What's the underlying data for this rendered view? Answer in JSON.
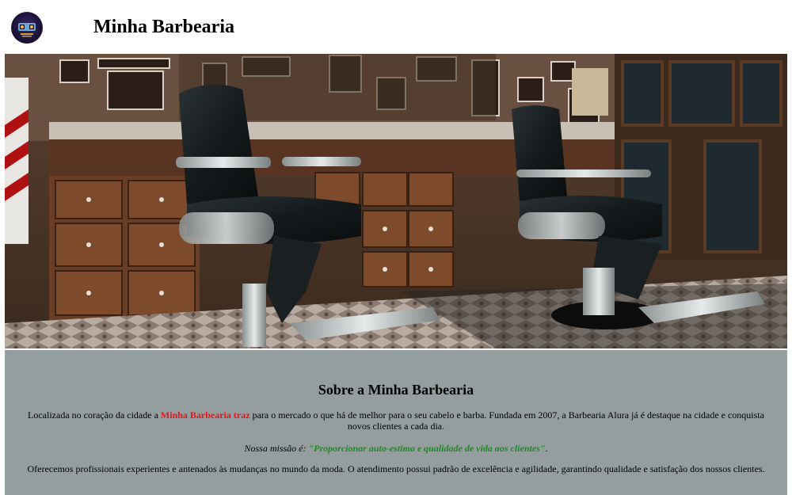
{
  "header": {
    "site_title": "Minha Barbearia",
    "logo_icon": "barber-logo-icon"
  },
  "banner": {
    "image": "barbershop-interior-photo"
  },
  "about": {
    "heading": "Sobre a Minha Barbearia",
    "paragraph1": {
      "prefix": "Localizada no coração da cidade a ",
      "highlight": "Minha Barbearia traz",
      "suffix": " para o mercado o que há de melhor para o seu cabelo e barba. Fundada em 2007, a Barbearia Alura já é destaque na cidade e conquista novos clientes a cada dia."
    },
    "mission": {
      "label": "Nossa missão é: ",
      "text": "\"Proporcionar auto-estima e qualidade de vida aos clientes\"",
      "end": "."
    },
    "paragraph3": "Oferecemos profissionais experientes e antenados às mudanças no mundo da moda. O atendimento possui padrão de excelência e agilidade, garantindo qualidade e satisfação dos nossos clientes."
  },
  "colors": {
    "about_background": "#949e9e",
    "highlight": "#e0181d",
    "mission": "#22882a"
  }
}
